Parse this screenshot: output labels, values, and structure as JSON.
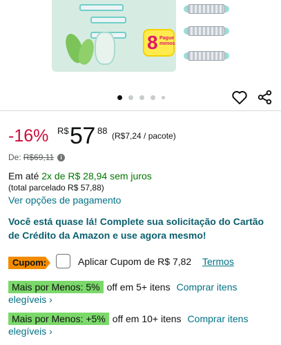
{
  "gallery": {
    "badge_number": "8",
    "badge_text": "Pague menos",
    "dots_count": 5,
    "active_dot": 0,
    "colors": {
      "package": "#d6ece2",
      "badge": "#ffeb4d",
      "badge_text": "#e0176b",
      "cartridge_ring": "#7fd6cf"
    }
  },
  "price": {
    "discount": "-16%",
    "currency": "R$",
    "whole": "57",
    "cents": "88",
    "unit_price": "(R$7,24 / pacote)"
  },
  "list_price": {
    "label": "De:",
    "value": "R$69,11"
  },
  "installments": {
    "prefix": "Em até",
    "highlight": "2x de R$ 28,94 sem juros",
    "total": "(total parcelado R$ 57,88)",
    "payment_link": "Ver opções de pagamento"
  },
  "promo_text": "Você está quase lá! Complete sua solicitação do Cartão de Crédito da Amazon e use agora mesmo!",
  "coupon": {
    "tag": "Cupom:",
    "text": "Aplicar Cupom de R$ 7,82",
    "terms": "Termos"
  },
  "more_for_less": [
    {
      "badge": "Mais por Menos: 5%",
      "off": "off em 5+ itens",
      "link": "Comprar itens elegíveis ›"
    },
    {
      "badge": "Mais por Menos: +5%",
      "off": "off em 10+ itens",
      "link": "Comprar itens elegíveis ›"
    }
  ],
  "colors": {
    "discount": "#cc0c39",
    "link": "#007185",
    "promo": "#0b5f6d",
    "installment_green": "#007600",
    "coupon_tag": "#f28b00",
    "mpm_badge": "#7bd86a"
  }
}
